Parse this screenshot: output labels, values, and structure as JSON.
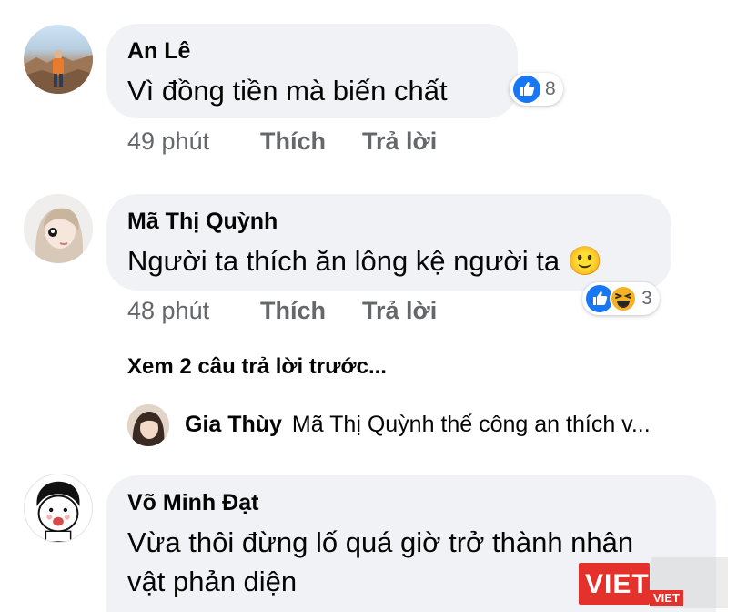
{
  "comments": [
    {
      "author": "An Lê",
      "text": "Vì đồng tiền mà biến chất",
      "time": "49 phút",
      "like_label": "Thích",
      "reply_label": "Trả lời",
      "reaction_count": "8",
      "reaction_icons": [
        "like-icon"
      ]
    },
    {
      "author": "Mã Thị Quỳnh",
      "text": "Người ta thích ăn lông kệ người ta 🙂",
      "time": "48 phút",
      "like_label": "Thích",
      "reply_label": "Trả lời",
      "reaction_count": "3",
      "reaction_icons": [
        "like-icon",
        "haha-icon"
      ]
    },
    {
      "author": "Võ Minh Đạt",
      "text_line1": "Vừa thôi đừng lố quá giờ trở thành nhân",
      "text_line2": "vật phản diện"
    }
  ],
  "view_replies": "Xem 2 câu trả lời trước...",
  "reply_preview": {
    "author": "Gia Thùy",
    "text": "Mã Thị Quỳnh thế công an thích v..."
  },
  "watermark": {
    "brand": "VIET",
    "sub": "VIET"
  },
  "colors": {
    "bubble": "#f0f2f5",
    "meta_text": "#65676b",
    "like_blue": "#1877f2",
    "haha_yellow": "#f7b125",
    "watermark_red": "#e4312b"
  }
}
